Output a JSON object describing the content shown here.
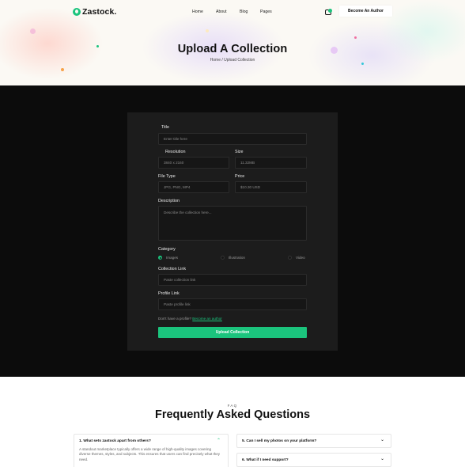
{
  "brand": {
    "name": "Zastock.",
    "accent": "#1bc47d"
  },
  "nav": {
    "items": [
      "Home",
      "About",
      "Blog",
      "Pages"
    ],
    "cta": "Become An Author"
  },
  "hero": {
    "title": "Upload A Collection",
    "breadcrumb": "Home / Upload Collection"
  },
  "form": {
    "title_label": "Title",
    "title_placeholder": "Enter title here",
    "resolution_label": "Resolution",
    "resolution_value": "3840 x 2160",
    "size_label": "Size",
    "size_value": "11.32MB",
    "filetype_label": "File Type",
    "filetype_value": "JPG, PNG, MP4",
    "price_label": "Price",
    "price_value": "$10.30 USD",
    "description_label": "Description",
    "description_placeholder": "Describe the collection here...",
    "category_label": "Category",
    "categories": [
      "Images",
      "Illustration",
      "Video"
    ],
    "selected_category": "Images",
    "collection_link_label": "Collection Link",
    "collection_link_placeholder": "Paste collection link",
    "profile_link_label": "Profile Link",
    "profile_link_placeholder": "Paste profile link",
    "no_profile_text": "Don't have a profile?",
    "become_author_link": "Become an author",
    "submit_label": "Upload Collection"
  },
  "faq": {
    "eyebrow": "FAQ",
    "title": "Frequently Asked Questions",
    "items": [
      {
        "q": "1. What sets zastock apart from others?",
        "a": "A standout marketplace typically offers a wide range of high-quality images covering diverse themes, styles, and subjects. This ensures that users can find precisely what they need.",
        "open": true
      },
      {
        "q": "5. Can I sell my photos on your platform?",
        "open": false
      },
      {
        "q": "6. What if I need support?",
        "open": false
      }
    ]
  }
}
